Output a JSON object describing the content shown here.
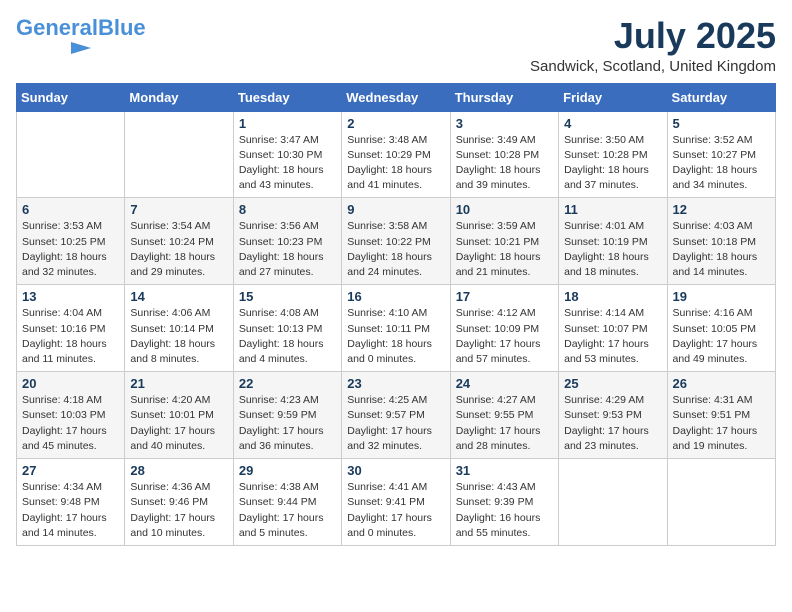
{
  "logo": {
    "line1": "General",
    "line2": "Blue",
    "tagline": ""
  },
  "title": "July 2025",
  "location": "Sandwick, Scotland, United Kingdom",
  "weekdays": [
    "Sunday",
    "Monday",
    "Tuesday",
    "Wednesday",
    "Thursday",
    "Friday",
    "Saturday"
  ],
  "weeks": [
    [
      null,
      null,
      {
        "day": "1",
        "info": "Sunrise: 3:47 AM\nSunset: 10:30 PM\nDaylight: 18 hours\nand 43 minutes."
      },
      {
        "day": "2",
        "info": "Sunrise: 3:48 AM\nSunset: 10:29 PM\nDaylight: 18 hours\nand 41 minutes."
      },
      {
        "day": "3",
        "info": "Sunrise: 3:49 AM\nSunset: 10:28 PM\nDaylight: 18 hours\nand 39 minutes."
      },
      {
        "day": "4",
        "info": "Sunrise: 3:50 AM\nSunset: 10:28 PM\nDaylight: 18 hours\nand 37 minutes."
      },
      {
        "day": "5",
        "info": "Sunrise: 3:52 AM\nSunset: 10:27 PM\nDaylight: 18 hours\nand 34 minutes."
      }
    ],
    [
      {
        "day": "6",
        "info": "Sunrise: 3:53 AM\nSunset: 10:25 PM\nDaylight: 18 hours\nand 32 minutes."
      },
      {
        "day": "7",
        "info": "Sunrise: 3:54 AM\nSunset: 10:24 PM\nDaylight: 18 hours\nand 29 minutes."
      },
      {
        "day": "8",
        "info": "Sunrise: 3:56 AM\nSunset: 10:23 PM\nDaylight: 18 hours\nand 27 minutes."
      },
      {
        "day": "9",
        "info": "Sunrise: 3:58 AM\nSunset: 10:22 PM\nDaylight: 18 hours\nand 24 minutes."
      },
      {
        "day": "10",
        "info": "Sunrise: 3:59 AM\nSunset: 10:21 PM\nDaylight: 18 hours\nand 21 minutes."
      },
      {
        "day": "11",
        "info": "Sunrise: 4:01 AM\nSunset: 10:19 PM\nDaylight: 18 hours\nand 18 minutes."
      },
      {
        "day": "12",
        "info": "Sunrise: 4:03 AM\nSunset: 10:18 PM\nDaylight: 18 hours\nand 14 minutes."
      }
    ],
    [
      {
        "day": "13",
        "info": "Sunrise: 4:04 AM\nSunset: 10:16 PM\nDaylight: 18 hours\nand 11 minutes."
      },
      {
        "day": "14",
        "info": "Sunrise: 4:06 AM\nSunset: 10:14 PM\nDaylight: 18 hours\nand 8 minutes."
      },
      {
        "day": "15",
        "info": "Sunrise: 4:08 AM\nSunset: 10:13 PM\nDaylight: 18 hours\nand 4 minutes."
      },
      {
        "day": "16",
        "info": "Sunrise: 4:10 AM\nSunset: 10:11 PM\nDaylight: 18 hours\nand 0 minutes."
      },
      {
        "day": "17",
        "info": "Sunrise: 4:12 AM\nSunset: 10:09 PM\nDaylight: 17 hours\nand 57 minutes."
      },
      {
        "day": "18",
        "info": "Sunrise: 4:14 AM\nSunset: 10:07 PM\nDaylight: 17 hours\nand 53 minutes."
      },
      {
        "day": "19",
        "info": "Sunrise: 4:16 AM\nSunset: 10:05 PM\nDaylight: 17 hours\nand 49 minutes."
      }
    ],
    [
      {
        "day": "20",
        "info": "Sunrise: 4:18 AM\nSunset: 10:03 PM\nDaylight: 17 hours\nand 45 minutes."
      },
      {
        "day": "21",
        "info": "Sunrise: 4:20 AM\nSunset: 10:01 PM\nDaylight: 17 hours\nand 40 minutes."
      },
      {
        "day": "22",
        "info": "Sunrise: 4:23 AM\nSunset: 9:59 PM\nDaylight: 17 hours\nand 36 minutes."
      },
      {
        "day": "23",
        "info": "Sunrise: 4:25 AM\nSunset: 9:57 PM\nDaylight: 17 hours\nand 32 minutes."
      },
      {
        "day": "24",
        "info": "Sunrise: 4:27 AM\nSunset: 9:55 PM\nDaylight: 17 hours\nand 28 minutes."
      },
      {
        "day": "25",
        "info": "Sunrise: 4:29 AM\nSunset: 9:53 PM\nDaylight: 17 hours\nand 23 minutes."
      },
      {
        "day": "26",
        "info": "Sunrise: 4:31 AM\nSunset: 9:51 PM\nDaylight: 17 hours\nand 19 minutes."
      }
    ],
    [
      {
        "day": "27",
        "info": "Sunrise: 4:34 AM\nSunset: 9:48 PM\nDaylight: 17 hours\nand 14 minutes."
      },
      {
        "day": "28",
        "info": "Sunrise: 4:36 AM\nSunset: 9:46 PM\nDaylight: 17 hours\nand 10 minutes."
      },
      {
        "day": "29",
        "info": "Sunrise: 4:38 AM\nSunset: 9:44 PM\nDaylight: 17 hours\nand 5 minutes."
      },
      {
        "day": "30",
        "info": "Sunrise: 4:41 AM\nSunset: 9:41 PM\nDaylight: 17 hours\nand 0 minutes."
      },
      {
        "day": "31",
        "info": "Sunrise: 4:43 AM\nSunset: 9:39 PM\nDaylight: 16 hours\nand 55 minutes."
      },
      null,
      null
    ]
  ]
}
